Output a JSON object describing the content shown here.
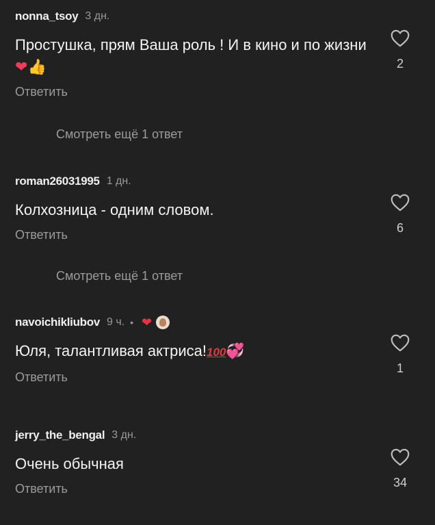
{
  "comments": [
    {
      "username": "nonna_tsoy",
      "time": "3 дн.",
      "text": "Простушка,  прям Ваша роль ! И в кино и по жизни",
      "emojis": [
        "❤",
        "👍"
      ],
      "reply": "Ответить",
      "likes": "2",
      "more_replies": "Смотреть ещё 1 ответ"
    },
    {
      "username": "roman26031995",
      "time": "1 дн.",
      "text": "Колхозница - одним словом.",
      "reply": "Ответить",
      "likes": "6",
      "more_replies": "Смотреть ещё 1 ответ"
    },
    {
      "username": "navoichikliubov",
      "time": "9 ч.",
      "separator": "•",
      "author_like": "❤",
      "text": "Юля, талантливая актриса!",
      "emojis": [
        "100",
        "💞"
      ],
      "reply": "Ответить",
      "likes": "1"
    },
    {
      "username": "jerry_the_bengal",
      "time": "3 дн.",
      "text": "Очень обычная",
      "reply": "Ответить",
      "likes": "34"
    }
  ],
  "icons": {
    "like": "heart-outline-icon",
    "author_like": "heart-filled-icon",
    "avatar": "author-avatar"
  },
  "colors": {
    "background": "#212121",
    "secondary_text": "#9c9c9c",
    "liked_heart": "#ed2f3f"
  }
}
